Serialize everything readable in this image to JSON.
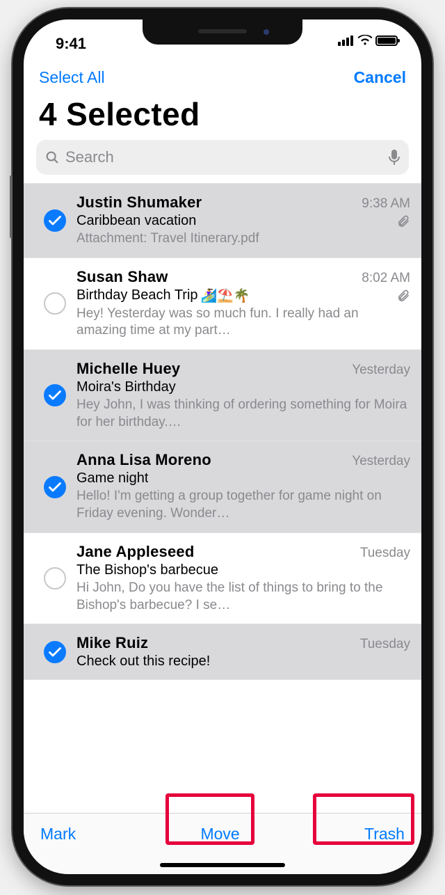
{
  "status": {
    "time": "9:41"
  },
  "nav": {
    "select_all": "Select All",
    "cancel": "Cancel"
  },
  "title": "4 Selected",
  "search": {
    "placeholder": "Search"
  },
  "toolbar": {
    "mark": "Mark",
    "move": "Move",
    "trash": "Trash"
  },
  "emails": [
    {
      "selected": true,
      "sender": "Justin Shumaker",
      "time": "9:38 AM",
      "subject": "Caribbean vacation",
      "emoji": "",
      "has_attachment": true,
      "preview": "Attachment: Travel Itinerary.pdf"
    },
    {
      "selected": false,
      "sender": "Susan Shaw",
      "time": "8:02 AM",
      "subject": "Birthday Beach Trip",
      "emoji": "🏄‍♀️⛱️🌴",
      "has_attachment": true,
      "preview": "Hey! Yesterday was so much fun. I really had an amazing time at my part…"
    },
    {
      "selected": true,
      "sender": "Michelle Huey",
      "time": "Yesterday",
      "subject": "Moira's Birthday",
      "emoji": "",
      "has_attachment": false,
      "preview": "Hey John, I was thinking of ordering something for Moira for her birthday.…"
    },
    {
      "selected": true,
      "sender": "Anna Lisa Moreno",
      "time": "Yesterday",
      "subject": "Game night",
      "emoji": "",
      "has_attachment": false,
      "preview": "Hello! I'm getting a group together for game night on Friday evening. Wonder…"
    },
    {
      "selected": false,
      "sender": "Jane Appleseed",
      "time": "Tuesday",
      "subject": "The Bishop's barbecue",
      "emoji": "",
      "has_attachment": false,
      "preview": "Hi John, Do you have the list of things to bring to the Bishop's barbecue? I se…"
    },
    {
      "selected": true,
      "sender": "Mike Ruiz",
      "time": "Tuesday",
      "subject": "Check out this recipe!",
      "emoji": "",
      "has_attachment": false,
      "preview": ""
    }
  ]
}
